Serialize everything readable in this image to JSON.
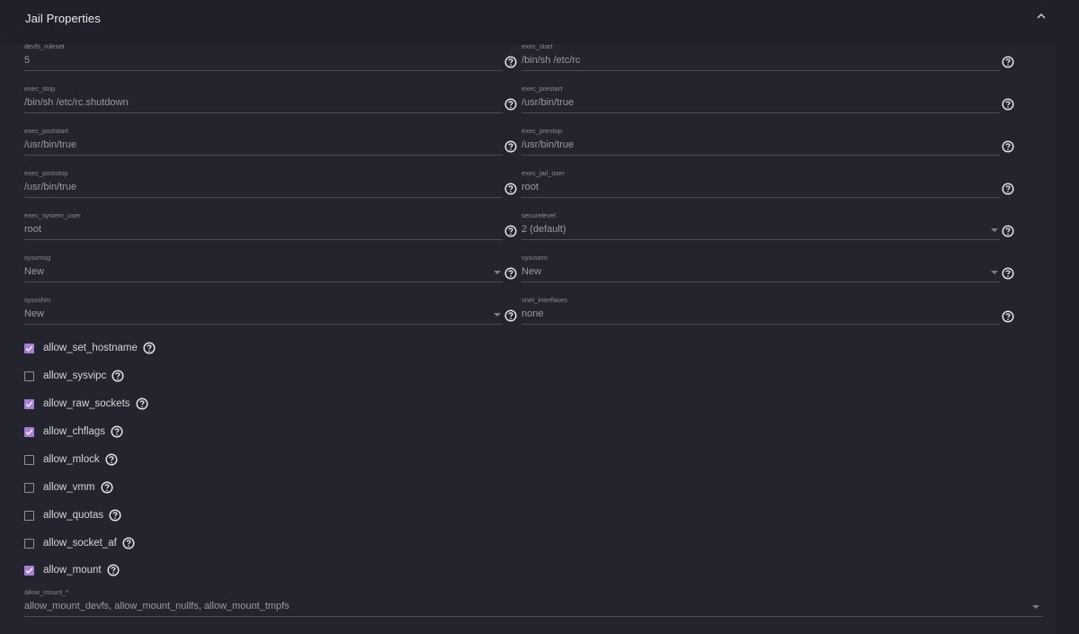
{
  "header": {
    "title": "Jail Properties"
  },
  "fields": {
    "devfs_ruleset": {
      "label": "devfs_ruleset",
      "value": "5"
    },
    "exec_start": {
      "label": "exec_start",
      "value": "/bin/sh /etc/rc"
    },
    "exec_stop": {
      "label": "exec_stop",
      "value": "/bin/sh /etc/rc.shutdown"
    },
    "exec_prestart": {
      "label": "exec_prestart",
      "value": "/usr/bin/true"
    },
    "exec_poststart": {
      "label": "exec_poststart",
      "value": "/usr/bin/true"
    },
    "exec_prestop": {
      "label": "exec_prestop",
      "value": "/usr/bin/true"
    },
    "exec_poststop": {
      "label": "exec_poststop",
      "value": "/usr/bin/true"
    },
    "exec_jail_user": {
      "label": "exec_jail_user",
      "value": "root"
    },
    "exec_system_user": {
      "label": "exec_system_user",
      "value": "root"
    },
    "securelevel": {
      "label": "securelevel",
      "value": "2 (default)"
    },
    "sysvmsg": {
      "label": "sysvmsg",
      "value": "New"
    },
    "sysvsem": {
      "label": "sysvsem",
      "value": "New"
    },
    "sysvshm": {
      "label": "sysvshm",
      "value": "New"
    },
    "vnet_interfaces": {
      "label": "vnet_interfaces",
      "value": "none"
    },
    "allow_mount_star": {
      "label": "allow_mount_*",
      "value": "allow_mount_devfs, allow_mount_nullfs, allow_mount_tmpfs"
    }
  },
  "checkboxes": [
    {
      "label": "allow_set_hostname",
      "checked": true
    },
    {
      "label": "allow_sysvipc",
      "checked": false
    },
    {
      "label": "allow_raw_sockets",
      "checked": true
    },
    {
      "label": "allow_chflags",
      "checked": true
    },
    {
      "label": "allow_mlock",
      "checked": false
    },
    {
      "label": "allow_vmm",
      "checked": false
    },
    {
      "label": "allow_quotas",
      "checked": false
    },
    {
      "label": "allow_socket_af",
      "checked": false
    },
    {
      "label": "allow_mount",
      "checked": true
    }
  ],
  "colors": {
    "accent": "#a580d4",
    "background": "#24242e",
    "header": "#20202a"
  },
  "icons": {
    "help": "help-circle-icon",
    "collapse": "chevron-up-icon",
    "dropdown": "caret-down-icon",
    "check": "check-icon"
  }
}
